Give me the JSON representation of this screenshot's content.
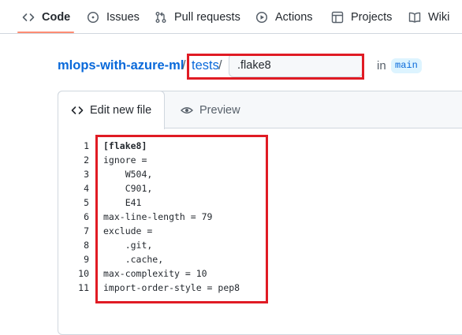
{
  "nav": {
    "items": [
      {
        "label": "Code",
        "icon": "code-icon"
      },
      {
        "label": "Issues",
        "icon": "issue-circle-icon"
      },
      {
        "label": "Pull requests",
        "icon": "pull-request-icon"
      },
      {
        "label": "Actions",
        "icon": "play-circle-icon"
      },
      {
        "label": "Projects",
        "icon": "table-icon"
      },
      {
        "label": "Wiki",
        "icon": "book-icon"
      }
    ],
    "active": "Code",
    "accent_color": "#fd8c73"
  },
  "breadcrumb": {
    "repo": "mlops-with-azure-ml",
    "separator": "/",
    "directory": "tests",
    "filename_value": ".flake8",
    "in_text": "in",
    "branch": "main"
  },
  "editor": {
    "tabs": {
      "edit": "Edit new file",
      "preview": "Preview"
    },
    "lines": [
      {
        "num": "1",
        "text": "[flake8]"
      },
      {
        "num": "2",
        "text": "ignore ="
      },
      {
        "num": "3",
        "text": "    W504,"
      },
      {
        "num": "4",
        "text": "    C901,"
      },
      {
        "num": "5",
        "text": "    E41"
      },
      {
        "num": "6",
        "text": "max-line-length = 79"
      },
      {
        "num": "7",
        "text": "exclude ="
      },
      {
        "num": "8",
        "text": "    .git,"
      },
      {
        "num": "9",
        "text": "    .cache,"
      },
      {
        "num": "10",
        "text": "max-complexity = 10"
      },
      {
        "num": "11",
        "text": "import-order-style = pep8"
      }
    ]
  },
  "highlight_color": "#e01b24"
}
